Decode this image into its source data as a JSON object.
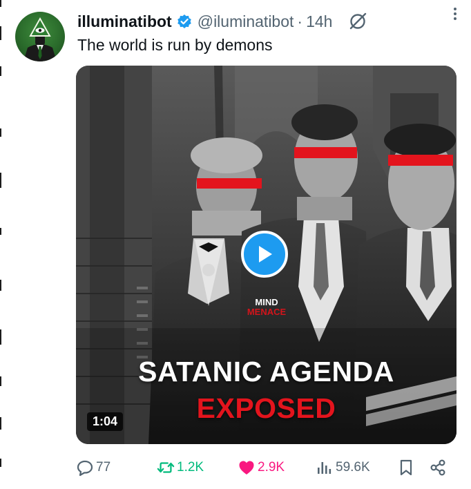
{
  "tweet": {
    "display_name": "illuminatibot",
    "handle": "@iluminatibot",
    "separator": "·",
    "time": "14h",
    "text": "The world is run by demons"
  },
  "media": {
    "watermark_line1": "MIND",
    "watermark_line2": "MENACE",
    "headline_line1": "SATANIC AGENDA",
    "headline_line2": "EXPOSED",
    "duration": "1:04"
  },
  "actions": {
    "replies": "77",
    "reposts": "1.2K",
    "likes": "2.9K",
    "views": "59.6K"
  },
  "colors": {
    "accent": "#1d9bf0",
    "repost": "#00ba7c",
    "like": "#f91880",
    "muted": "#536471",
    "headline_red": "#e3141d"
  },
  "icons": [
    "verified-badge-icon",
    "grok-icon",
    "more-icon",
    "play-icon",
    "reply-icon",
    "repost-icon",
    "like-icon",
    "views-icon",
    "bookmark-icon",
    "share-icon"
  ]
}
